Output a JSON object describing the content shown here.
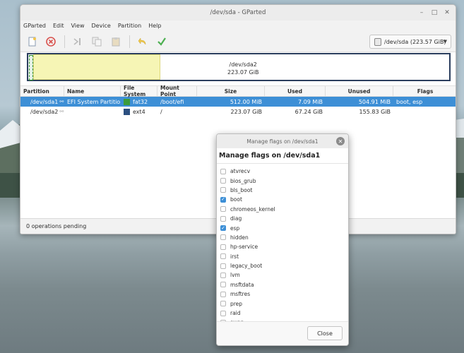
{
  "window": {
    "title": "/dev/sda - GParted"
  },
  "menu": [
    "GParted",
    "Edit",
    "View",
    "Device",
    "Partition",
    "Help"
  ],
  "toolbar": {
    "icons": [
      "new-icon",
      "delete-icon",
      "resize-icon",
      "copy-icon",
      "paste-icon",
      "undo-icon",
      "apply-icon"
    ],
    "device_selector": "/dev/sda (223.57 GiB)"
  },
  "diskmap": {
    "partition_label": "/dev/sda2",
    "partition_size": "223.07 GiB"
  },
  "table": {
    "headers": [
      "Partition",
      "Name",
      "File System",
      "Mount Point",
      "Size",
      "Used",
      "Unused",
      "Flags"
    ],
    "rows": [
      {
        "partition": "/dev/sda1",
        "name": "EFI System Partition",
        "fs": "fat32",
        "fs_color": "#3c9b3c",
        "mount": "/boot/efi",
        "size": "512.00 MiB",
        "used": "7.09 MiB",
        "unused": "504.91 MiB",
        "flags": "boot, esp"
      },
      {
        "partition": "/dev/sda2",
        "name": "",
        "fs": "ext4",
        "fs_color": "#2b4f80",
        "mount": "/",
        "size": "223.07 GiB",
        "used": "67.24 GiB",
        "unused": "155.83 GiB",
        "flags": ""
      }
    ]
  },
  "status": "0 operations pending",
  "dialog": {
    "title": "Manage flags on /dev/sda1",
    "heading": "Manage flags on /dev/sda1",
    "close_label": "Close",
    "flags": [
      {
        "label": "atvrecv",
        "checked": false
      },
      {
        "label": "bios_grub",
        "checked": false
      },
      {
        "label": "bls_boot",
        "checked": false
      },
      {
        "label": "boot",
        "checked": true
      },
      {
        "label": "chromeos_kernel",
        "checked": false
      },
      {
        "label": "diag",
        "checked": false
      },
      {
        "label": "esp",
        "checked": true
      },
      {
        "label": "hidden",
        "checked": false
      },
      {
        "label": "hp-service",
        "checked": false
      },
      {
        "label": "irst",
        "checked": false
      },
      {
        "label": "legacy_boot",
        "checked": false
      },
      {
        "label": "lvm",
        "checked": false
      },
      {
        "label": "msftdata",
        "checked": false
      },
      {
        "label": "msftres",
        "checked": false
      },
      {
        "label": "prep",
        "checked": false
      },
      {
        "label": "raid",
        "checked": false
      },
      {
        "label": "swap",
        "checked": false
      }
    ]
  }
}
